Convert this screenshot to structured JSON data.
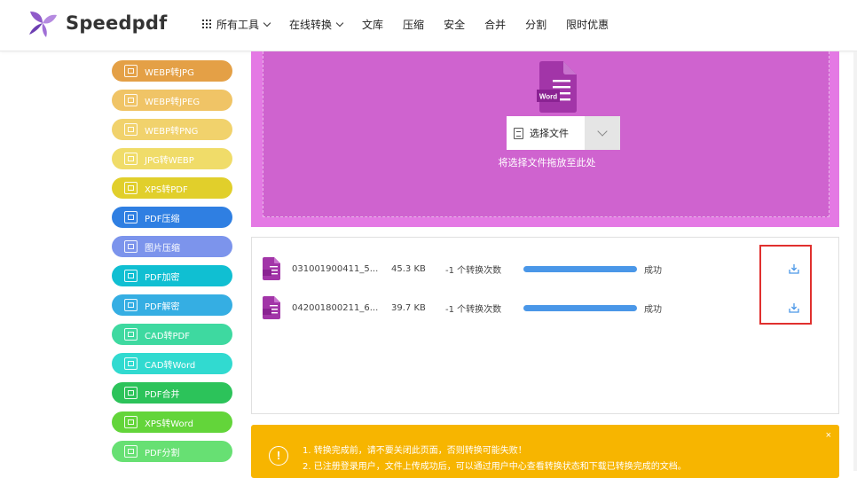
{
  "header": {
    "brand": "Speedpdf",
    "nav": [
      {
        "label": "所有工具",
        "icon": "grid-icon",
        "dropdown": true
      },
      {
        "label": "在线转换",
        "dropdown": true
      },
      {
        "label": "文库"
      },
      {
        "label": "压缩"
      },
      {
        "label": "安全"
      },
      {
        "label": "合并"
      },
      {
        "label": "分割"
      },
      {
        "label": "限时优惠"
      }
    ]
  },
  "sidebar": {
    "items": [
      {
        "label": "WEBP转JPG",
        "color": "#e4a046"
      },
      {
        "label": "WEBP转JPEG",
        "color": "#f0c466"
      },
      {
        "label": "WEBP转PNG",
        "color": "#f1d26c"
      },
      {
        "label": "JPG转WEBP",
        "color": "#f0dc69"
      },
      {
        "label": "XPS转PDF",
        "color": "#e1cf2b"
      },
      {
        "label": "PDF压缩",
        "color": "#2f7fe2"
      },
      {
        "label": "图片压缩",
        "color": "#7c94ec"
      },
      {
        "label": "PDF加密",
        "color": "#10bfd2"
      },
      {
        "label": "PDF解密",
        "color": "#35aee3"
      },
      {
        "label": "CAD转PDF",
        "color": "#3ed9a0"
      },
      {
        "label": "CAD转Word",
        "color": "#31dad0"
      },
      {
        "label": "PDF合并",
        "color": "#2cc35a"
      },
      {
        "label": "XPS转Word",
        "color": "#63d53a"
      },
      {
        "label": "PDF分割",
        "color": "#67e073"
      }
    ]
  },
  "upload": {
    "icon_label": "Word",
    "select_button": "选择文件",
    "drop_hint": "将选择文件拖放至此处"
  },
  "files": [
    {
      "name": "031001900411_5...",
      "size": "45.3 KB",
      "conversions": "-1 个转换次数",
      "progress": 1.0,
      "status": "成功"
    },
    {
      "name": "042001800211_6...",
      "size": "39.7 KB",
      "conversions": "-1 个转换次数",
      "progress": 1.0,
      "status": "成功"
    }
  ],
  "notice": {
    "icon": "!",
    "lines": [
      "1. 转换完成前，请不要关闭此页面，否则转换可能失败！",
      "2. 已注册登录用户，文件上传成功后，可以通过用户中心查看转换状态和下载已转换完成的文档。"
    ],
    "close": "×"
  },
  "colors": {
    "upload_outer": "#e479e4",
    "upload_inner": "#cf63cf",
    "word_icon": "#a235a8",
    "progress": "#4a97e8",
    "notice": "#f7b500",
    "highlight": "#e0302e"
  }
}
